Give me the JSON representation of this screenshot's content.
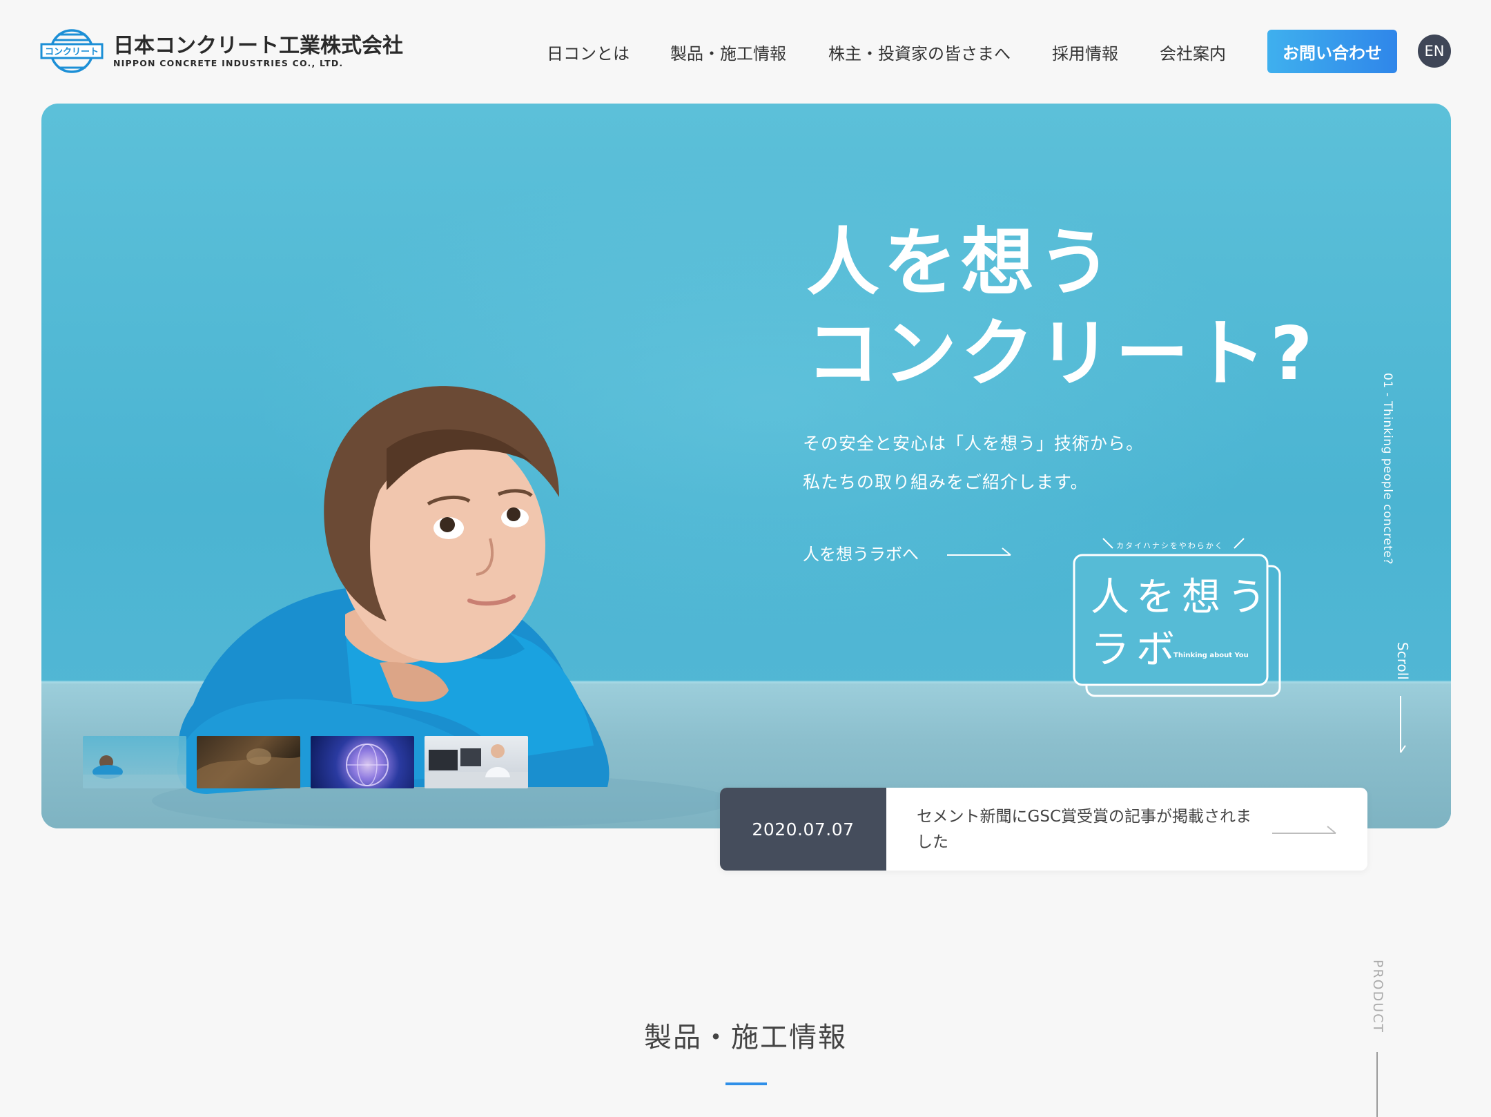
{
  "header": {
    "logo_mark_text": "コンクリート",
    "logo_ja": "日本コンクリート工業株式会社",
    "logo_en": "NIPPON CONCRETE INDUSTRIES CO., LTD.",
    "nav": [
      "日コンとは",
      "製品・施工情報",
      "株主・投資家の皆さまへ",
      "採用情報",
      "会社案内"
    ],
    "contact_label": "お問い合わせ",
    "lang_label": "EN"
  },
  "hero": {
    "title_line1": "人を想う",
    "title_line2": "コンクリート?",
    "sub_line1": "その安全と安心は「人を想う」技術から。",
    "sub_line2": "私たちの取り組みをご紹介します。",
    "lab_link": "人を想うラボへ",
    "lab_logo": {
      "tagline": "カタイハナシをやわらかく",
      "line1": "人を想う",
      "line2": "ラボ",
      "english": "Thinking about You"
    },
    "vertical_caption": "01 - Thinking people concrete?",
    "scroll_label": "Scroll",
    "thumbnails": [
      "child",
      "ruins",
      "globe",
      "office-worker"
    ]
  },
  "news": {
    "date": "2020.07.07",
    "text": "セメント新聞にGSC賞受賞の記事が掲載されました"
  },
  "product_section": {
    "title": "製品・施工情報",
    "vertical_label": "PRODUCT",
    "accent_color": "#2f8fe8"
  },
  "colors": {
    "hero_bg": "#4bb4d2",
    "contact_button": "#2f86ea",
    "news_date_bg": "#454d5c",
    "lang_button_bg": "#3f4657"
  }
}
